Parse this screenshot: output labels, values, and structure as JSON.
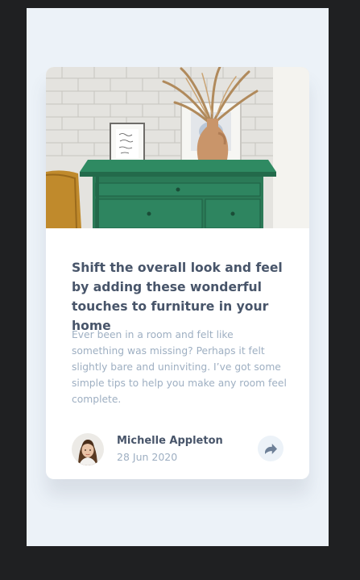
{
  "card": {
    "title": "Shift the overall look and feel by adding these wonderful touches to furniture in your home",
    "description": "Ever been in a room and felt like something was missing? Perhaps it felt slightly bare and uninviting. I’ve got some simple tips to help you make any room feel complete.",
    "image_icon": "drawers-photo",
    "author": {
      "name": "Michelle Appleton",
      "date": "28 Jun 2020",
      "avatar_icon": "avatar-photo"
    },
    "share_icon": "share-icon"
  },
  "colors": {
    "page_background": "#1f2022",
    "panel_background": "#ecf2f8",
    "card_background": "#ffffff",
    "title_text": "#48556a",
    "muted_text": "#9eafc2",
    "dresser_green": "#2b7a57"
  }
}
